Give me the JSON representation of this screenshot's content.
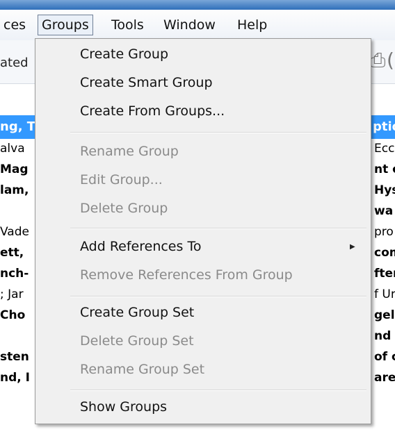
{
  "menubar": {
    "items": [
      {
        "label": "ces"
      },
      {
        "label": "Groups"
      },
      {
        "label": "Tools"
      },
      {
        "label": "Window"
      },
      {
        "label": "Help"
      }
    ]
  },
  "toolbar": {
    "partial_label": "ated"
  },
  "table": {
    "header_left": "ng, T",
    "header_right": "ptic",
    "rows": [
      {
        "left": "alva",
        "right": "Ecc",
        "bold": false
      },
      {
        "left": "Mag",
        "right": "nt o",
        "bold": true
      },
      {
        "left": "lam,",
        "right": "Hys",
        "bold": true
      },
      {
        "left": "",
        "right": "wa",
        "bold": true
      },
      {
        "left": "Vade",
        "right": "pro",
        "bold": false
      },
      {
        "left": "ett, ",
        "right": "com",
        "bold": true
      },
      {
        "left": "nch-",
        "right": "fter",
        "bold": true
      },
      {
        "left": "; Jar",
        "right": "f Ur",
        "bold": false
      },
      {
        "left": "Cho",
        "right": "gel",
        "bold": true
      },
      {
        "left": "",
        "right": "nd",
        "bold": true
      },
      {
        "left": "sten",
        "right": "of c",
        "bold": true
      },
      {
        "left": "nd, I",
        "right": "are",
        "bold": true
      }
    ]
  },
  "groups_menu": {
    "create_group": "Create Group",
    "create_smart_group": "Create Smart Group",
    "create_from_groups": "Create From Groups...",
    "rename_group": "Rename Group",
    "edit_group": "Edit Group...",
    "delete_group": "Delete Group",
    "add_references_to": "Add References To",
    "remove_references": "Remove References From Group",
    "create_group_set": "Create Group Set",
    "delete_group_set": "Delete Group Set",
    "rename_group_set": "Rename Group Set",
    "show_groups": "Show Groups",
    "submenu_icon": "triangle-right-icon"
  }
}
